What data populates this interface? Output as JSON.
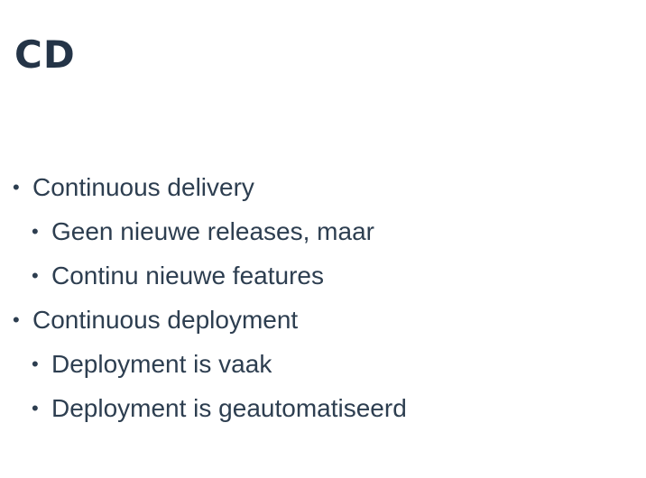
{
  "slide": {
    "title": "CD",
    "bullets": [
      {
        "level": 1,
        "text": "Continuous delivery"
      },
      {
        "level": 2,
        "text": "Geen nieuwe releases, maar"
      },
      {
        "level": 2,
        "text": "Continu nieuwe features"
      },
      {
        "level": 1,
        "text": "Continuous deployment"
      },
      {
        "level": 2,
        "text": "Deployment is vaak"
      },
      {
        "level": 2,
        "text": "Deployment is geautomatiseerd"
      }
    ],
    "colors": {
      "background": "#ffffff",
      "title": "#243447",
      "text": "#2d3e50"
    }
  }
}
